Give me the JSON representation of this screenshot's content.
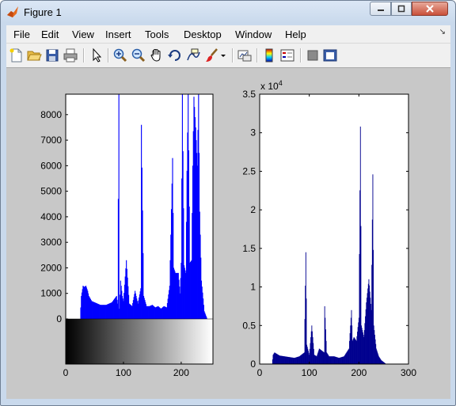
{
  "window": {
    "title": "Figure 1",
    "controls": [
      "minimize",
      "maximize",
      "close"
    ]
  },
  "menubar": {
    "items": [
      "File",
      "Edit",
      "View",
      "Insert",
      "Tools",
      "Desktop",
      "Window",
      "Help"
    ],
    "dock_arrow": "↘"
  },
  "toolbar": {
    "buttons": [
      "new-figure-icon",
      "open-file-icon",
      "save-icon",
      "print-icon",
      "edit-plot-arrow-icon",
      "zoom-in-icon",
      "zoom-out-icon",
      "pan-hand-icon",
      "rotate-3d-icon",
      "data-cursor-icon",
      "brush-icon",
      "brush-dropdown-icon",
      "link-plot-icon",
      "insert-colorbar-icon",
      "insert-legend-icon",
      "hide-plot-tools-icon",
      "show-plot-tools-icon"
    ]
  },
  "colors": {
    "left_hist": "#0000ff",
    "right_hist": "#00008f",
    "figure_bg": "#c8c8c8",
    "axes_bg": "#ffffff"
  },
  "chart_data": [
    {
      "type": "bar",
      "title": "",
      "xlabel": "",
      "ylabel": "",
      "xlim": [
        0,
        255
      ],
      "ylim": [
        0,
        8800
      ],
      "xticks": [
        "0",
        "100",
        "200"
      ],
      "yticks": [
        "0",
        "1000",
        "2000",
        "3000",
        "4000",
        "5000",
        "6000",
        "7000",
        "8000"
      ],
      "colorbar": "grayscale 0-255 under x-axis",
      "x": [
        0,
        25,
        27,
        30,
        32,
        35,
        38,
        40,
        45,
        50,
        55,
        60,
        70,
        80,
        88,
        90,
        92,
        93,
        95,
        98,
        100,
        105,
        110,
        115,
        120,
        125,
        130,
        131,
        135,
        140,
        145,
        150,
        155,
        160,
        165,
        170,
        175,
        180,
        185,
        187,
        190,
        195,
        198,
        200,
        202,
        205,
        208,
        210,
        212,
        215,
        218,
        220,
        222,
        225,
        228,
        230,
        232,
        235,
        238,
        240,
        245,
        250,
        255
      ],
      "values": [
        0,
        0,
        900,
        1300,
        1250,
        1300,
        1100,
        900,
        700,
        650,
        600,
        550,
        550,
        650,
        900,
        600,
        8800,
        400,
        1500,
        900,
        700,
        2300,
        600,
        500,
        1100,
        600,
        1200,
        7600,
        900,
        500,
        500,
        550,
        450,
        500,
        400,
        500,
        450,
        1300,
        6300,
        2000,
        1800,
        1800,
        1000,
        2200,
        8800,
        2100,
        1800,
        5800,
        8800,
        2200,
        2300,
        6000,
        8700,
        7500,
        6000,
        8800,
        4200,
        1500,
        800,
        300,
        0,
        0,
        0
      ]
    },
    {
      "type": "bar",
      "title": "",
      "xlabel": "",
      "ylabel": "",
      "exponent_label": "x 10^4",
      "xlim": [
        0,
        300
      ],
      "ylim": [
        0,
        3.5
      ],
      "xticks": [
        "0",
        "100",
        "200",
        "300"
      ],
      "yticks": [
        "0",
        "0.5",
        "1",
        "1.5",
        "2",
        "2.5",
        "3",
        "3.5"
      ],
      "x": [
        0,
        25,
        27,
        30,
        35,
        40,
        50,
        60,
        70,
        80,
        90,
        93,
        95,
        100,
        105,
        110,
        115,
        120,
        130,
        131,
        135,
        140,
        150,
        160,
        170,
        180,
        185,
        187,
        190,
        195,
        200,
        203,
        205,
        210,
        215,
        220,
        225,
        228,
        230,
        235,
        240,
        245,
        255
      ],
      "values": [
        0,
        0,
        0.12,
        0.15,
        0.13,
        0.11,
        0.1,
        0.09,
        0.08,
        0.1,
        0.15,
        1.45,
        0.25,
        0.12,
        0.5,
        0.12,
        0.1,
        0.2,
        0.15,
        0.75,
        0.15,
        0.1,
        0.1,
        0.08,
        0.1,
        0.2,
        0.7,
        0.3,
        0.35,
        0.3,
        0.6,
        3.08,
        0.5,
        0.35,
        0.8,
        1.1,
        0.7,
        2.46,
        0.5,
        0.2,
        0.1,
        0.05,
        0
      ]
    }
  ]
}
